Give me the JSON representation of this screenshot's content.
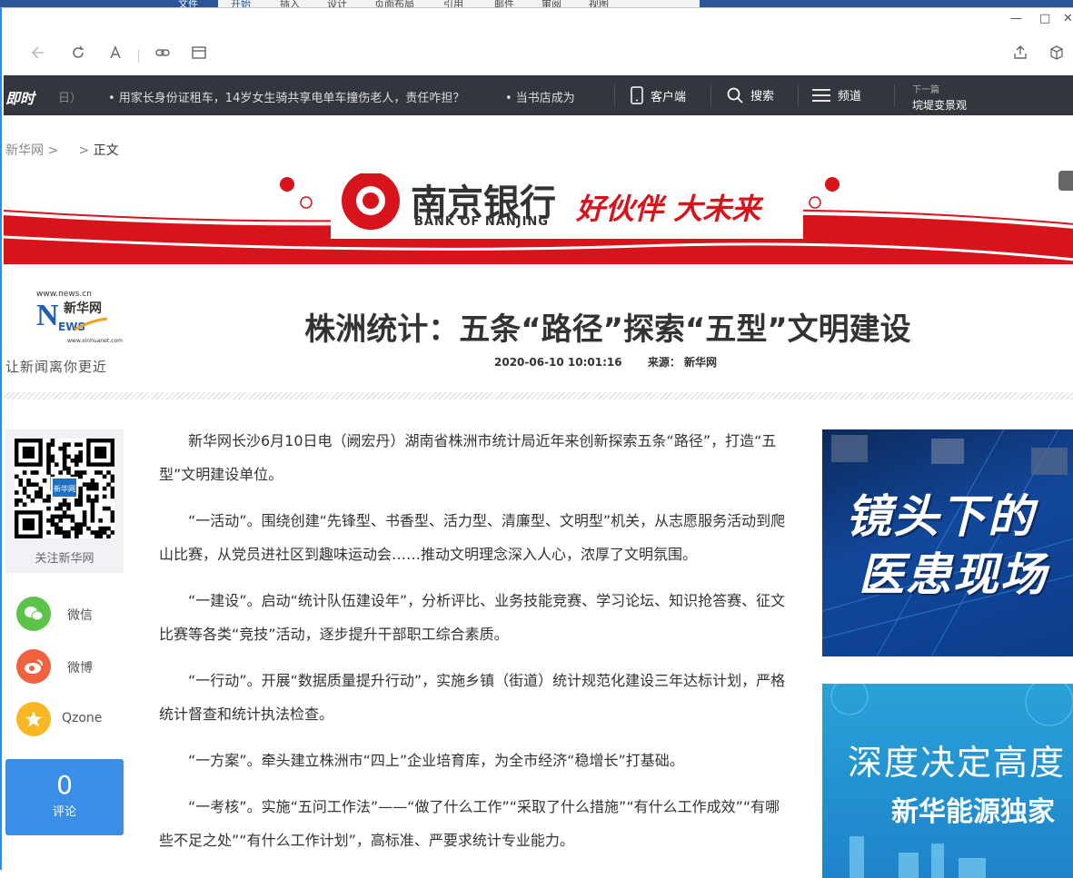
{
  "office_ribbon": {
    "tabs": [
      "文件",
      "开始",
      "插入",
      "设计",
      "页面布局",
      "引用",
      "邮件",
      "审阅",
      "视图"
    ]
  },
  "browser": {
    "window_controls": [
      "—",
      "□",
      "✕"
    ],
    "toolbar_icons": [
      "back-icon",
      "refresh-icon",
      "font-icon",
      "link-icon",
      "reader-icon",
      "share-icon",
      "extension-icon"
    ]
  },
  "topnav": {
    "logo": "即时",
    "date_fragment": "日）",
    "news_items": [
      "• 用家长身份证租车，14岁女生骑共享电单车撞伤老人，责任咋担？",
      "• 当书店成为"
    ],
    "client_label": "客户端",
    "search_label": "搜索",
    "channel_label": "频道",
    "next_label": "下一篇",
    "next_title": "垸堤变景观"
  },
  "breadcrumb": {
    "home": "新华网",
    "sep1": ">",
    "sep2": ">",
    "current": "正文"
  },
  "banner": {
    "brand_cn": "南京银行",
    "brand_en": "BANK OF NANJING",
    "slogan": "好伙伴 大未来",
    "accent": "#d7141c"
  },
  "header": {
    "logo_url": "www.news.cn",
    "logo_url2": "www.xinhuanet.com",
    "logo_cn": "新华网",
    "logo_n": "N",
    "logo_ews": "EWS",
    "slogan": "让新闻离你更近",
    "title": "株洲统计：五条“路径”探索“五型”文明建设",
    "datetime": "2020-06-10 10:01:16",
    "source": "来源： 新华网"
  },
  "share": {
    "qr_label": "关注新华网",
    "qr_center": "新华网",
    "wechat": "微信",
    "weibo": "微博",
    "qzone": "Qzone",
    "comment_count": "0",
    "comment_label": "评论",
    "colors": {
      "wechat": "#5cc34a",
      "weibo": "#f0623f",
      "qzone": "#f7b824",
      "comment": "#3a8ee6"
    }
  },
  "article": {
    "paragraphs": [
      "新华网长沙6月10日电（阙宏丹）湖南省株洲市统计局近年来创新探索五条“路径”，打造“五型”文明建设单位。",
      "“一活动”。围绕创建“先锋型、书香型、活力型、清廉型、文明型”机关，从志愿服务活动到爬山比赛，从党员进社区到趣味运动会……推动文明理念深入人心，浓厚了文明氛围。",
      "“一建设”。启动“统计队伍建设年”，分析评比、业务技能竞赛、学习论坛、知识抢答赛、征文比赛等各类“竞技”活动，逐步提升干部职工综合素质。",
      "“一行动”。开展“数据质量提升行动”，实施乡镇（街道）统计规范化建设三年达标计划，严格统计督查和统计执法检查。",
      "“一方案”。牵头建立株洲市“四上”企业培育库，为全市经济“稳增长”打基础。",
      "“一考核”。实施“五问工作法”——“做了什么工作”“采取了什么措施”“有什么工作成效”“有哪些不足之处”“有什么工作计划”，高标准、严要求统计专业能力。"
    ]
  },
  "right_ads": {
    "ad1_line1": "镜头下的",
    "ad1_line2": "医患现场",
    "ad2_line1": "深度决定高度",
    "ad2_line2": "新华能源独家"
  }
}
